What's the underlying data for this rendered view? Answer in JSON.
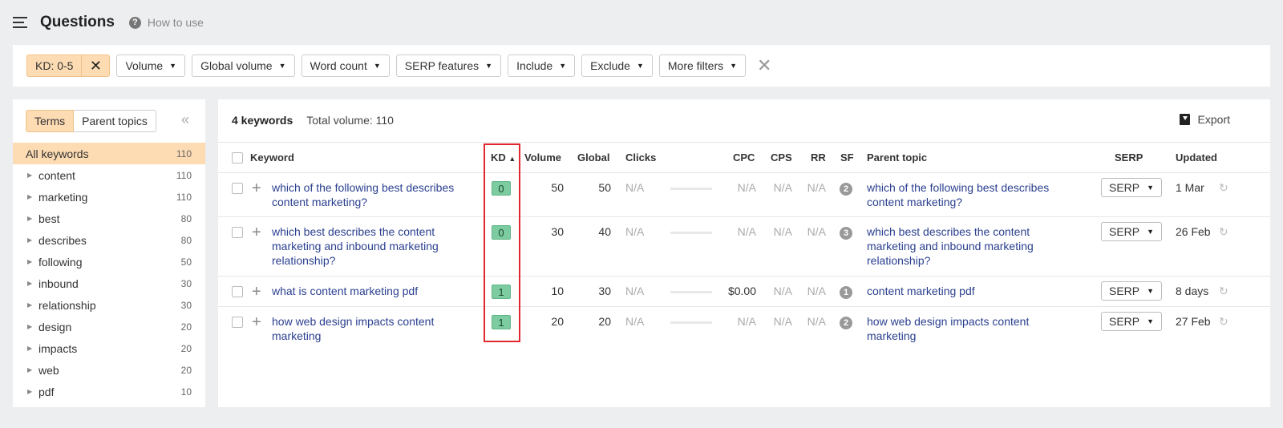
{
  "header": {
    "title": "Questions",
    "help": "How to use"
  },
  "filters": {
    "active_chip": "KD: 0-5",
    "buttons": [
      "Volume",
      "Global volume",
      "Word count",
      "SERP features",
      "Include",
      "Exclude",
      "More filters"
    ]
  },
  "sidebar": {
    "tabs": [
      "Terms",
      "Parent topics"
    ],
    "items": [
      {
        "label": "All keywords",
        "count": "110"
      },
      {
        "label": "content",
        "count": "110"
      },
      {
        "label": "marketing",
        "count": "110"
      },
      {
        "label": "best",
        "count": "80"
      },
      {
        "label": "describes",
        "count": "80"
      },
      {
        "label": "following",
        "count": "50"
      },
      {
        "label": "inbound",
        "count": "30"
      },
      {
        "label": "relationship",
        "count": "30"
      },
      {
        "label": "design",
        "count": "20"
      },
      {
        "label": "impacts",
        "count": "20"
      },
      {
        "label": "web",
        "count": "20"
      },
      {
        "label": "pdf",
        "count": "10"
      }
    ]
  },
  "main": {
    "keywords_count": "4 keywords",
    "total_volume": "Total volume: 110",
    "export": "Export",
    "columns": {
      "keyword": "Keyword",
      "kd": "KD",
      "volume": "Volume",
      "global": "Global",
      "clicks": "Clicks",
      "cpc": "CPC",
      "cps": "CPS",
      "rr": "RR",
      "sf": "SF",
      "parent": "Parent topic",
      "serp": "SERP",
      "updated": "Updated"
    },
    "rows": [
      {
        "keyword_l1": "which of the following best describes",
        "keyword_l2": "content marketing?",
        "keyword_l3": "",
        "kd": "0",
        "volume": "50",
        "global": "50",
        "clicks": "N/A",
        "cpc": "N/A",
        "cps": "N/A",
        "rr": "N/A",
        "sf": "2",
        "parent_l1": "which of the following best describes",
        "parent_l2": "content marketing?",
        "parent_l3": "",
        "serp": "SERP",
        "updated": "1 Mar"
      },
      {
        "keyword_l1": "which best describes the content",
        "keyword_l2": "marketing and inbound marketing",
        "keyword_l3": "relationship?",
        "kd": "0",
        "volume": "30",
        "global": "40",
        "clicks": "N/A",
        "cpc": "N/A",
        "cps": "N/A",
        "rr": "N/A",
        "sf": "3",
        "parent_l1": "which best describes the content",
        "parent_l2": "marketing and inbound marketing",
        "parent_l3": "relationship?",
        "serp": "SERP",
        "updated": "26 Feb"
      },
      {
        "keyword_l1": "what is content marketing pdf",
        "keyword_l2": "",
        "keyword_l3": "",
        "kd": "1",
        "volume": "10",
        "global": "30",
        "clicks": "N/A",
        "cpc": "$0.00",
        "cps": "N/A",
        "rr": "N/A",
        "sf": "1",
        "parent_l1": "content marketing pdf",
        "parent_l2": "",
        "parent_l3": "",
        "serp": "SERP",
        "updated": "8 days"
      },
      {
        "keyword_l1": "how web design impacts content",
        "keyword_l2": "marketing",
        "keyword_l3": "",
        "kd": "1",
        "volume": "20",
        "global": "20",
        "clicks": "N/A",
        "cpc": "N/A",
        "cps": "N/A",
        "rr": "N/A",
        "sf": "2",
        "parent_l1": "how web design impacts content",
        "parent_l2": "marketing",
        "parent_l3": "",
        "serp": "SERP",
        "updated": "27 Feb"
      }
    ]
  },
  "colors": {
    "accent": "#fddbb3",
    "kd_green": "#7dcba0",
    "link": "#2a3f8f",
    "highlight": "#e0282e"
  }
}
